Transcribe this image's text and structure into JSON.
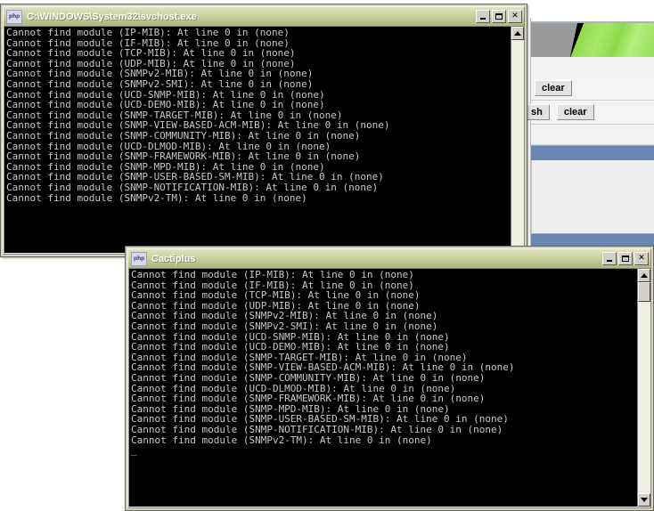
{
  "background_page": {
    "name": "cacti-web-page",
    "buttons": [
      {
        "label": "clear"
      },
      {
        "label": "sh"
      },
      {
        "label": "clear"
      }
    ],
    "colors": {
      "banner_gray": "#9a9a9a",
      "banner_green": "#8fd94a",
      "header_blue": "#6a87b4",
      "panel_gray": "#eeeeee"
    }
  },
  "windows": [
    {
      "id": "svchost",
      "title": "C:\\WINDOWS\\System32\\svchost.exe",
      "icon": "php-icon",
      "controls": {
        "minimize": "minimize-button",
        "maximize": "maximize-button",
        "close": "close-button"
      },
      "console_lines": [
        "Cannot find module (IP-MIB): At line 0 in (none)",
        "Cannot find module (IF-MIB): At line 0 in (none)",
        "Cannot find module (TCP-MIB): At line 0 in (none)",
        "Cannot find module (UDP-MIB): At line 0 in (none)",
        "Cannot find module (SNMPv2-MIB): At line 0 in (none)",
        "Cannot find module (SNMPv2-SMI): At line 0 in (none)",
        "Cannot find module (UCD-SNMP-MIB): At line 0 in (none)",
        "Cannot find module (UCD-DEMO-MIB): At line 0 in (none)",
        "Cannot find module (SNMP-TARGET-MIB): At line 0 in (none)",
        "Cannot find module (SNMP-VIEW-BASED-ACM-MIB): At line 0 in (none)",
        "Cannot find module (SNMP-COMMUNITY-MIB): At line 0 in (none)",
        "Cannot find module (UCD-DLMOD-MIB): At line 0 in (none)",
        "Cannot find module (SNMP-FRAMEWORK-MIB): At line 0 in (none)",
        "Cannot find module (SNMP-MPD-MIB): At line 0 in (none)",
        "Cannot find module (SNMP-USER-BASED-SM-MIB): At line 0 in (none)",
        "Cannot find module (SNMP-NOTIFICATION-MIB): At line 0 in (none)",
        "Cannot find module (SNMPv2-TM): At line 0 in (none)"
      ],
      "cursor": "",
      "scrollbar": {
        "up": "▲",
        "down": "▼"
      }
    },
    {
      "id": "cactiplus",
      "title": "Cactiplus",
      "icon": "php-icon",
      "controls": {
        "minimize": "minimize-button",
        "maximize": "maximize-button",
        "close": "close-button"
      },
      "console_lines": [
        "Cannot find module (IP-MIB): At line 0 in (none)",
        "Cannot find module (IF-MIB): At line 0 in (none)",
        "Cannot find module (TCP-MIB): At line 0 in (none)",
        "Cannot find module (UDP-MIB): At line 0 in (none)",
        "Cannot find module (SNMPv2-MIB): At line 0 in (none)",
        "Cannot find module (SNMPv2-SMI): At line 0 in (none)",
        "Cannot find module (UCD-SNMP-MIB): At line 0 in (none)",
        "Cannot find module (UCD-DEMO-MIB): At line 0 in (none)",
        "Cannot find module (SNMP-TARGET-MIB): At line 0 in (none)",
        "Cannot find module (SNMP-VIEW-BASED-ACM-MIB): At line 0 in (none)",
        "Cannot find module (SNMP-COMMUNITY-MIB): At line 0 in (none)",
        "Cannot find module (UCD-DLMOD-MIB): At line 0 in (none)",
        "Cannot find module (SNMP-FRAMEWORK-MIB): At line 0 in (none)",
        "Cannot find module (SNMP-MPD-MIB): At line 0 in (none)",
        "Cannot find module (SNMP-USER-BASED-SM-MIB): At line 0 in (none)",
        "Cannot find module (SNMP-NOTIFICATION-MIB): At line 0 in (none)",
        "Cannot find module (SNMPv2-TM): At line 0 in (none)"
      ],
      "cursor": "_",
      "scrollbar": {
        "up": "▲",
        "down": "▼"
      }
    }
  ],
  "icons": {
    "php_label": "php"
  }
}
